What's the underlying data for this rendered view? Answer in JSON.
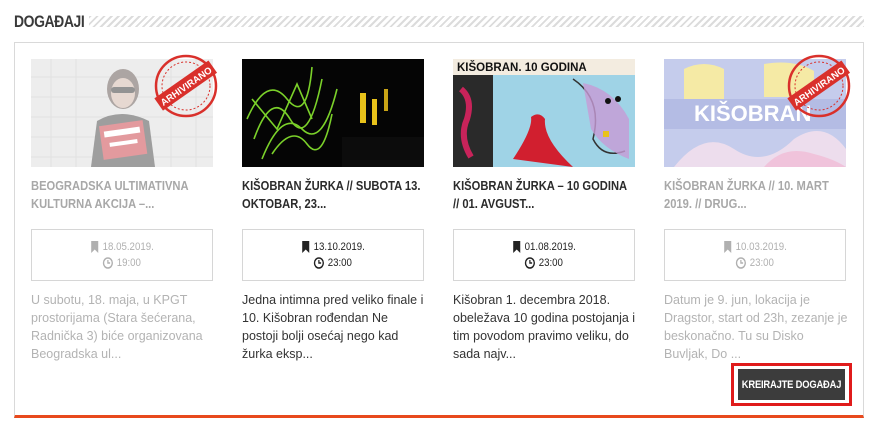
{
  "section": {
    "title": "DOGAĐAJI"
  },
  "cards": [
    {
      "title": "BEOGRADSKA ULTIMATIVNA KULTURNA AKCIJA –...",
      "date": "18.05.2019.",
      "time": "19:00",
      "description": "U subotu, 18. maja, u KPGT prostorijama (Stara šećerana, Radnička 3) biće organizovana Beogradska ul...",
      "archived": true,
      "stamp_text": "ARHIVIRANO"
    },
    {
      "title": "KIŠOBRAN ŽURKA // SUBOTA 13. OKTOBAR, 23...",
      "date": "13.10.2019.",
      "time": "23:00",
      "description": "Jedna intimna pred veliko finale i 10. Kišobran rođendan Ne postoji bolji osećaj nego kad žurka eksp...",
      "archived": false
    },
    {
      "title": "KIŠOBRAN ŽURKA – 10 GODINA // 01. AVGUST...",
      "date": "01.08.2019.",
      "time": "23:00",
      "description": "Kišobran 1. decembra 2018. obeležava 10 godina postojanja i tim povodom pravimo veliku, do sada najv...",
      "archived": false,
      "poster_text": "KIŠOBRAN. 10 GODINA"
    },
    {
      "title": "KIŠOBRAN ŽURKA // 10. MART 2019. // DRUG...",
      "date": "10.03.2019.",
      "time": "23:00",
      "description": "Datum je 9. jun, lokacija je Dragstor, start od 23h, zezanje je beskonačno. Tu su Disko Buvljak, Do ...",
      "archived": true,
      "stamp_text": "ARHIVIRANO",
      "poster_text": "KIŠOBRAN"
    }
  ],
  "create_button": {
    "label": "KREIRAJTE DOGAĐAJ"
  },
  "colors": {
    "accent": "#e8491d",
    "highlight": "#e01b1b",
    "button_bg": "#3c3c3c",
    "stamp": "#d9302b"
  }
}
